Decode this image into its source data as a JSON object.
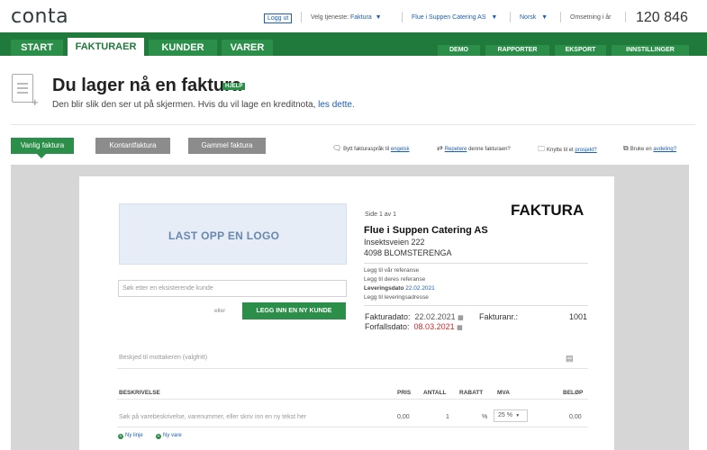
{
  "app": {
    "logo": "conta"
  },
  "topbar": {
    "logout": "Logg ut",
    "service_label": "Velg tjeneste:",
    "service_value": "Faktura",
    "company_value": "Flue i Suppen Catering AS",
    "language_value": "Norsk",
    "turnover_label": "Omsetning i år",
    "turnover_value": "120 846"
  },
  "nav": {
    "tabs": [
      "START",
      "FAKTURAER",
      "KUNDER",
      "VARER"
    ],
    "active_tab": "FAKTURAER",
    "right_tabs": [
      "DEMO",
      "RAPPORTER",
      "EKSPORT",
      "INNSTILLINGER"
    ]
  },
  "header": {
    "title": "Du lager nå en faktura",
    "help": "HJELP",
    "subtitle": "Den blir slik den ser ut på skjermen. Hvis du vil lage en kreditnota,",
    "subtitle_link": "les dette."
  },
  "invoice_types": [
    "Vanlig faktura",
    "Kontantfaktura",
    "Gammel faktura"
  ],
  "options": {
    "language_prefix": "Bytt fakturaspråk til",
    "language_link": "engelsk",
    "repeat_link": "Repetere",
    "repeat_suffix": "denne fakturaen?",
    "project_prefix": "Knytte til et",
    "project_link": "prosjekt?",
    "department_prefix": "Bruke en",
    "department_link": "avdeling?"
  },
  "invoice": {
    "logo_upload": "LAST OPP EN LOGO",
    "page_indicator": "Side 1 av 1",
    "heading": "FAKTURA",
    "company_name": "Flue i Suppen Catering AS",
    "address_line1": "Insektsveien 222",
    "address_line2": "4098 BLOMSTERENGA",
    "our_ref": "Legg til vår referanse",
    "their_ref": "Legg til deres referanse",
    "delivery_date_label": "Leveringsdato",
    "delivery_date_value": "22.02.2021",
    "delivery_address": "Legg til leveringsadresse",
    "customer_search_placeholder": "Søk etter en eksisterende kunde",
    "or": "eller",
    "new_customer_button": "LEGG INN EN NY KUNDE",
    "invoice_date_label": "Fakturadato:",
    "invoice_date_value": "22.02.2021",
    "due_date_label": "Forfallsdato:",
    "due_date_value": "08.03.2021",
    "invoice_number_label": "Fakturanr.:",
    "invoice_number_value": "1001",
    "message_placeholder": "Beskjed til mottakeren (valgfritt)",
    "columns": {
      "description": "BESKRIVELSE",
      "price": "PRIS",
      "quantity": "ANTALL",
      "discount": "RABATT",
      "vat": "MVA",
      "amount": "BELØP"
    },
    "line": {
      "description_placeholder": "Søk på varebeskrivelse, varenummer, eller skriv inn en ny tekst her",
      "price": "0,00",
      "quantity": "1",
      "discount_unit": "%",
      "vat": "25 %",
      "amount": "0,00"
    },
    "add_line": "Ny linje",
    "add_product": "Ny vare"
  },
  "colors": {
    "brand_green": "#1f7a3c",
    "accent_green": "#2b8f49",
    "link_blue": "#1a5fb4",
    "due_red": "#d62828"
  }
}
